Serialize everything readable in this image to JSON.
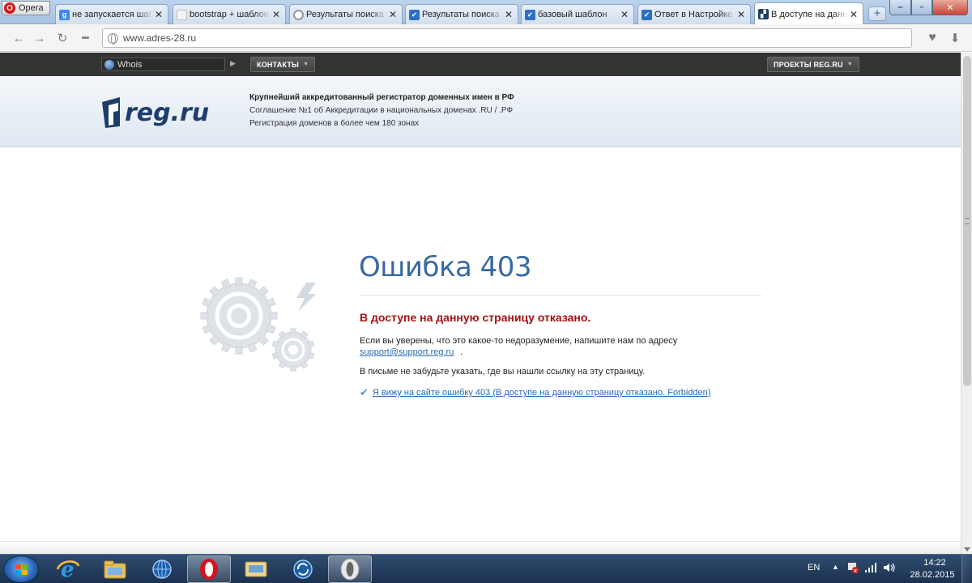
{
  "browser": {
    "menu_label": "Opera",
    "tabs": [
      {
        "title": "не запускается шаблон",
        "icon": "google-icon",
        "color": "#4285f4",
        "glyph": "g"
      },
      {
        "title": "bootstrap + шаблон",
        "icon": "page-icon",
        "color": "#f3f3f3",
        "glyph": ""
      },
      {
        "title": "Результаты поиска",
        "icon": "loading-icon",
        "color": "#ffffff",
        "glyph": ""
      },
      {
        "title": "Результаты поиска",
        "icon": "stackoverflow-check-icon",
        "color": "#2f6fc0",
        "glyph": "✔"
      },
      {
        "title": "базовый шаблон",
        "icon": "stackoverflow-check-icon",
        "color": "#2f6fc0",
        "glyph": "✔"
      },
      {
        "title": "Ответ в Настройке",
        "icon": "stackoverflow-check-icon",
        "color": "#2f6fc0",
        "glyph": "✔"
      },
      {
        "title": "В доступе на данную",
        "icon": "regru-icon",
        "color": "#1d3d6b",
        "glyph": "▞",
        "active": true
      }
    ],
    "new_tab_label": "+",
    "url": "www.adres-28.ru"
  },
  "site": {
    "whois_label": "Whois",
    "contacts_label": "КОНТАКТЫ",
    "projects_label": "ПРОЕКТЫ REG.RU",
    "logo_text": "reg.ru",
    "tagline_title": "Крупнейший аккредитованный регистратор доменных имен в РФ",
    "tagline_line2": "Соглашение №1 об Аккредитации в национальных доменах .RU / .РФ",
    "tagline_line3": "Регистрация доменов в более чем 180 зонах"
  },
  "error": {
    "title": "Ошибка 403",
    "denied": "В доступе на данную страницу отказано.",
    "para1": "Если вы уверены, что это какое-то недоразумение, напишите нам по адресу",
    "email": "support@support.reg.ru",
    "email_suffix": ".",
    "para2": "В письме не забудьте указать, где вы нашли ссылку на эту страницу.",
    "report_link": "Я вижу на сайте ошибку 403 (В доступе на данную страницу отказано. Forbidden)"
  },
  "taskbar": {
    "apps": [
      "ie-icon",
      "explorer-icon",
      "network-globe-icon",
      "opera-icon",
      "mail-icon",
      "sync-icon",
      "opera-gray-icon"
    ],
    "lang": "EN",
    "time": "14:22",
    "date": "28.02.2015"
  },
  "colors": {
    "error_title": "#3768a3",
    "denied": "#a31313",
    "link": "#2a6ab5"
  }
}
